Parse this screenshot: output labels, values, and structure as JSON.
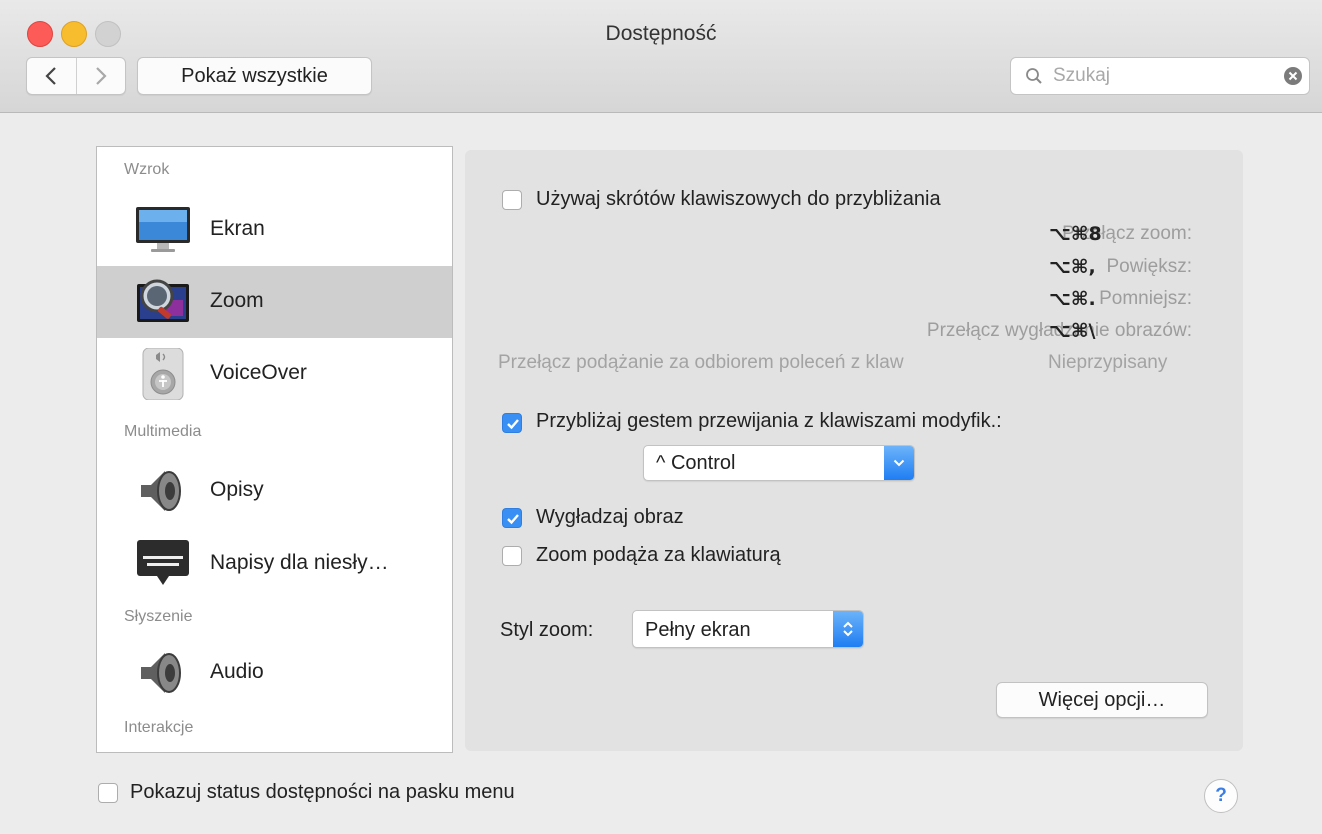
{
  "window": {
    "title": "Dostępność"
  },
  "toolbar": {
    "show_all_label": "Pokaż wszystkie",
    "search_placeholder": "Szukaj"
  },
  "sidebar": {
    "sections": [
      {
        "label": "Wzrok"
      },
      {
        "label": "Multimedia"
      },
      {
        "label": "Słyszenie"
      },
      {
        "label": "Interakcje"
      }
    ],
    "items": [
      {
        "label": "Ekran",
        "icon": "display-icon",
        "selected": false
      },
      {
        "label": "Zoom",
        "icon": "zoom-magnifier-icon",
        "selected": true
      },
      {
        "label": "VoiceOver",
        "icon": "voiceover-icon",
        "selected": false
      },
      {
        "label": "Opisy",
        "icon": "speaker-icon",
        "selected": false
      },
      {
        "label": "Napisy dla niesły…",
        "icon": "captions-icon",
        "selected": false
      },
      {
        "label": "Audio",
        "icon": "speaker-icon",
        "selected": false
      }
    ]
  },
  "zoom": {
    "keyboard_shortcuts": {
      "label": "Używaj skrótów klawiszowych do przybliżania",
      "checked": false
    },
    "shortcuts": [
      {
        "label": "Przełącz zoom:",
        "keys": "⌥⌘8"
      },
      {
        "label": "Powiększ:",
        "keys": "⌥⌘,"
      },
      {
        "label": "Pomniejsz:",
        "keys": "⌥⌘."
      },
      {
        "label": "Przełącz wygładzanie obrazów:",
        "keys": "⌥⌘\\"
      }
    ],
    "focus_follow": {
      "label": "Przełącz podążanie za odbiorem poleceń z klaw",
      "value": "Nieprzypisany"
    },
    "scroll_gesture": {
      "label": "Przybliżaj gestem przewijania z klawiszami modyfik.:",
      "checked": true
    },
    "modifier_select": {
      "value": "^ Control"
    },
    "smooth_images": {
      "label": "Wygładzaj obraz",
      "checked": true
    },
    "follow_keyboard": {
      "label": "Zoom podąża za klawiaturą",
      "checked": false
    },
    "zoom_style": {
      "label": "Styl zoom:",
      "value": "Pełny ekran"
    },
    "more_options_label": "Więcej opcji…"
  },
  "footer": {
    "menu_status": {
      "label": "Pokazuj status dostępności na pasku menu",
      "checked": false
    },
    "help_label": "?"
  },
  "colors": {
    "accent": "#3a8ff5",
    "selection": "#cfcfcf",
    "panel": "#e2e2e2"
  }
}
